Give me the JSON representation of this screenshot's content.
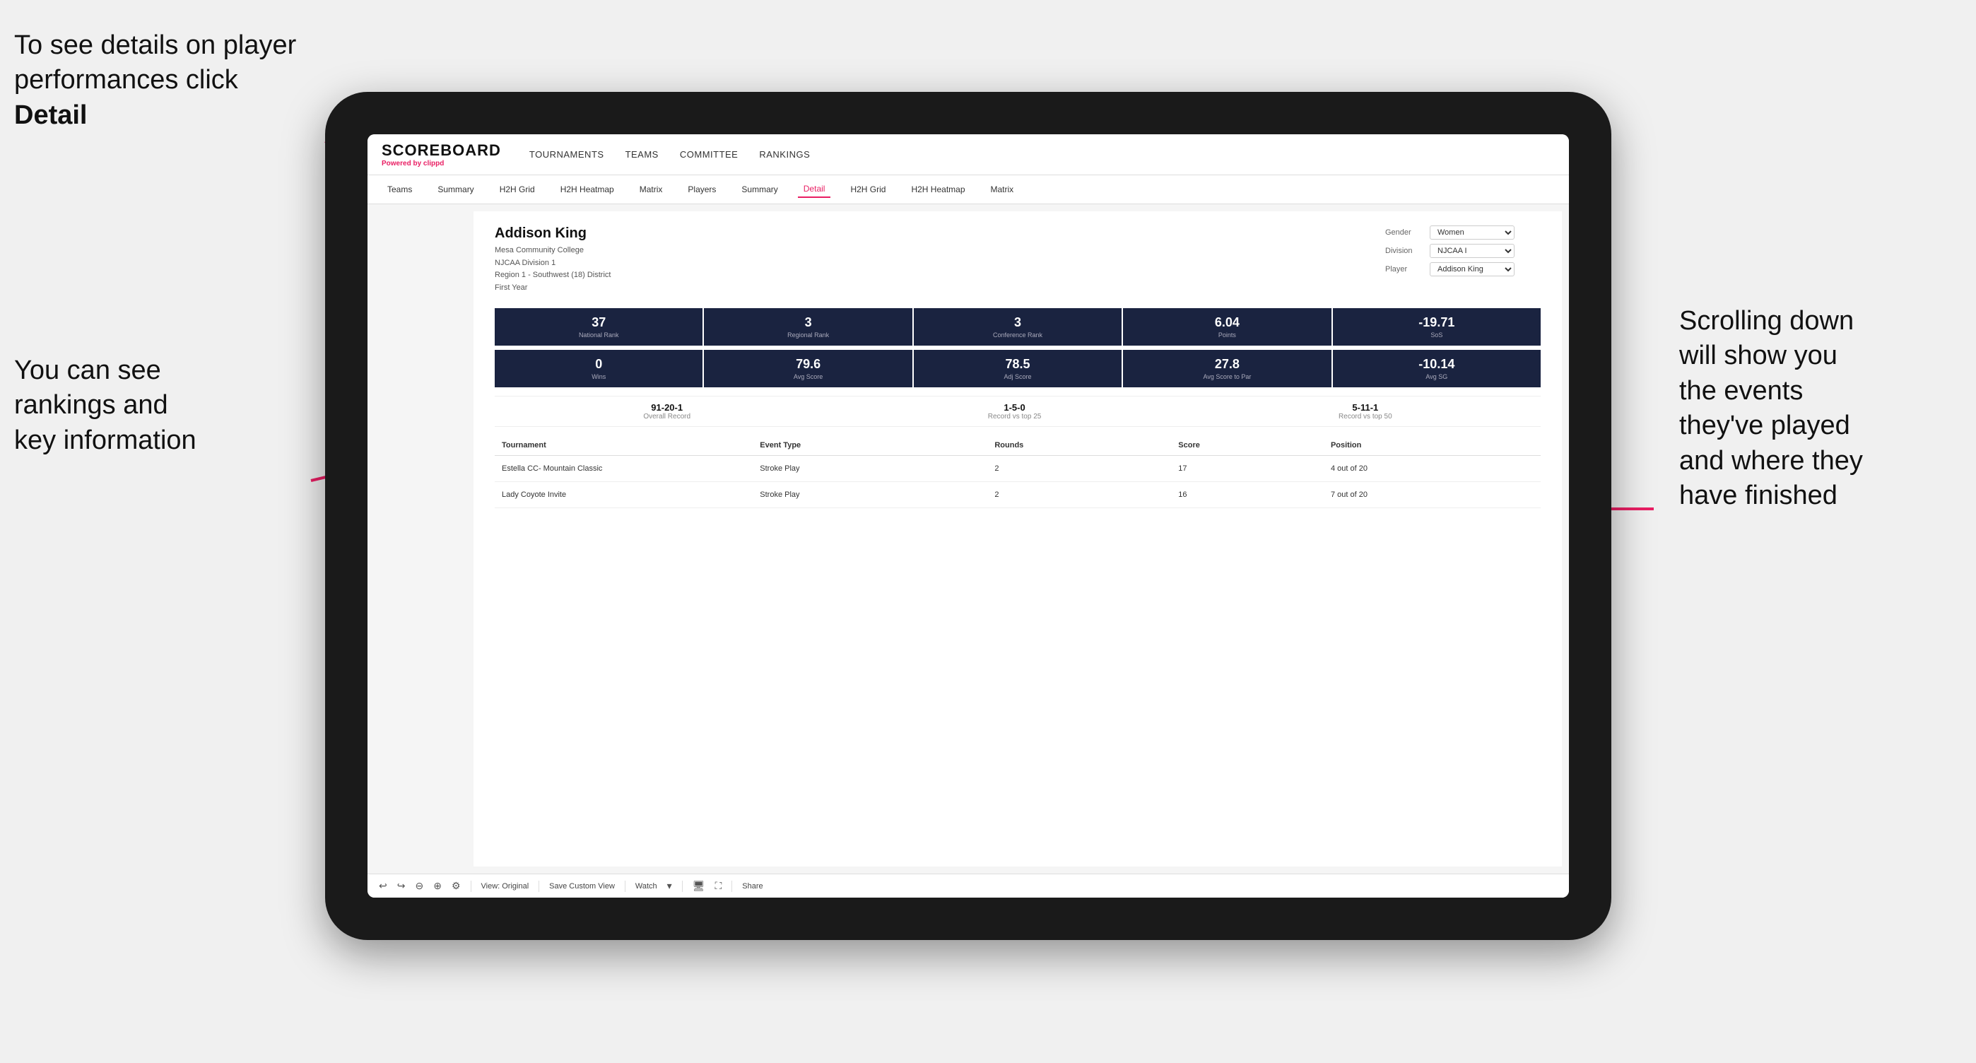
{
  "annotations": {
    "top_left": "To see details on player performances click ",
    "top_left_bold": "Detail",
    "bottom_left_line1": "You can see",
    "bottom_left_line2": "rankings and",
    "bottom_left_line3": "key information",
    "right_line1": "Scrolling down",
    "right_line2": "will show you",
    "right_line3": "the events",
    "right_line4": "they've played",
    "right_line5": "and where they",
    "right_line6": "have finished"
  },
  "nav": {
    "logo": "SCOREBOARD",
    "powered_by": "Powered by ",
    "brand": "clippd",
    "items": [
      {
        "label": "TOURNAMENTS",
        "active": false
      },
      {
        "label": "TEAMS",
        "active": false
      },
      {
        "label": "COMMITTEE",
        "active": false
      },
      {
        "label": "RANKINGS",
        "active": false
      }
    ]
  },
  "sub_nav": {
    "items": [
      {
        "label": "Teams",
        "active": false
      },
      {
        "label": "Summary",
        "active": false
      },
      {
        "label": "H2H Grid",
        "active": false
      },
      {
        "label": "H2H Heatmap",
        "active": false
      },
      {
        "label": "Matrix",
        "active": false
      },
      {
        "label": "Players",
        "active": false
      },
      {
        "label": "Summary",
        "active": false
      },
      {
        "label": "Detail",
        "active": true
      },
      {
        "label": "H2H Grid",
        "active": false
      },
      {
        "label": "H2H Heatmap",
        "active": false
      },
      {
        "label": "Matrix",
        "active": false
      }
    ]
  },
  "player": {
    "name": "Addison King",
    "school": "Mesa Community College",
    "division": "NJCAA Division 1",
    "region": "Region 1 - Southwest (18) District",
    "year": "First Year"
  },
  "filters": {
    "gender_label": "Gender",
    "gender_value": "Women",
    "division_label": "Division",
    "division_value": "NJCAA I",
    "player_label": "Player",
    "player_value": "Addison King"
  },
  "stats_row1": [
    {
      "value": "37",
      "label": "National Rank"
    },
    {
      "value": "3",
      "label": "Regional Rank"
    },
    {
      "value": "3",
      "label": "Conference Rank"
    },
    {
      "value": "6.04",
      "label": "Points"
    },
    {
      "value": "-19.71",
      "label": "SoS"
    }
  ],
  "stats_row2": [
    {
      "value": "0",
      "label": "Wins"
    },
    {
      "value": "79.6",
      "label": "Avg Score"
    },
    {
      "value": "78.5",
      "label": "Adj Score"
    },
    {
      "value": "27.8",
      "label": "Avg Score to Par"
    },
    {
      "value": "-10.14",
      "label": "Avg SG"
    }
  ],
  "records": [
    {
      "value": "91-20-1",
      "label": "Overall Record"
    },
    {
      "value": "1-5-0",
      "label": "Record vs top 25"
    },
    {
      "value": "5-11-1",
      "label": "Record vs top 50"
    }
  ],
  "table": {
    "headers": [
      "Tournament",
      "",
      "Event Type",
      "Rounds",
      "Score",
      "Position"
    ],
    "rows": [
      {
        "tournament": "Estella CC- Mountain Classic",
        "event_type": "Stroke Play",
        "rounds": "2",
        "score": "17",
        "position": "4 out of 20"
      },
      {
        "tournament": "Lady Coyote Invite",
        "event_type": "Stroke Play",
        "rounds": "2",
        "score": "16",
        "position": "7 out of 20"
      }
    ]
  },
  "toolbar": {
    "view_original": "View: Original",
    "save_custom": "Save Custom View",
    "watch": "Watch",
    "share": "Share"
  }
}
